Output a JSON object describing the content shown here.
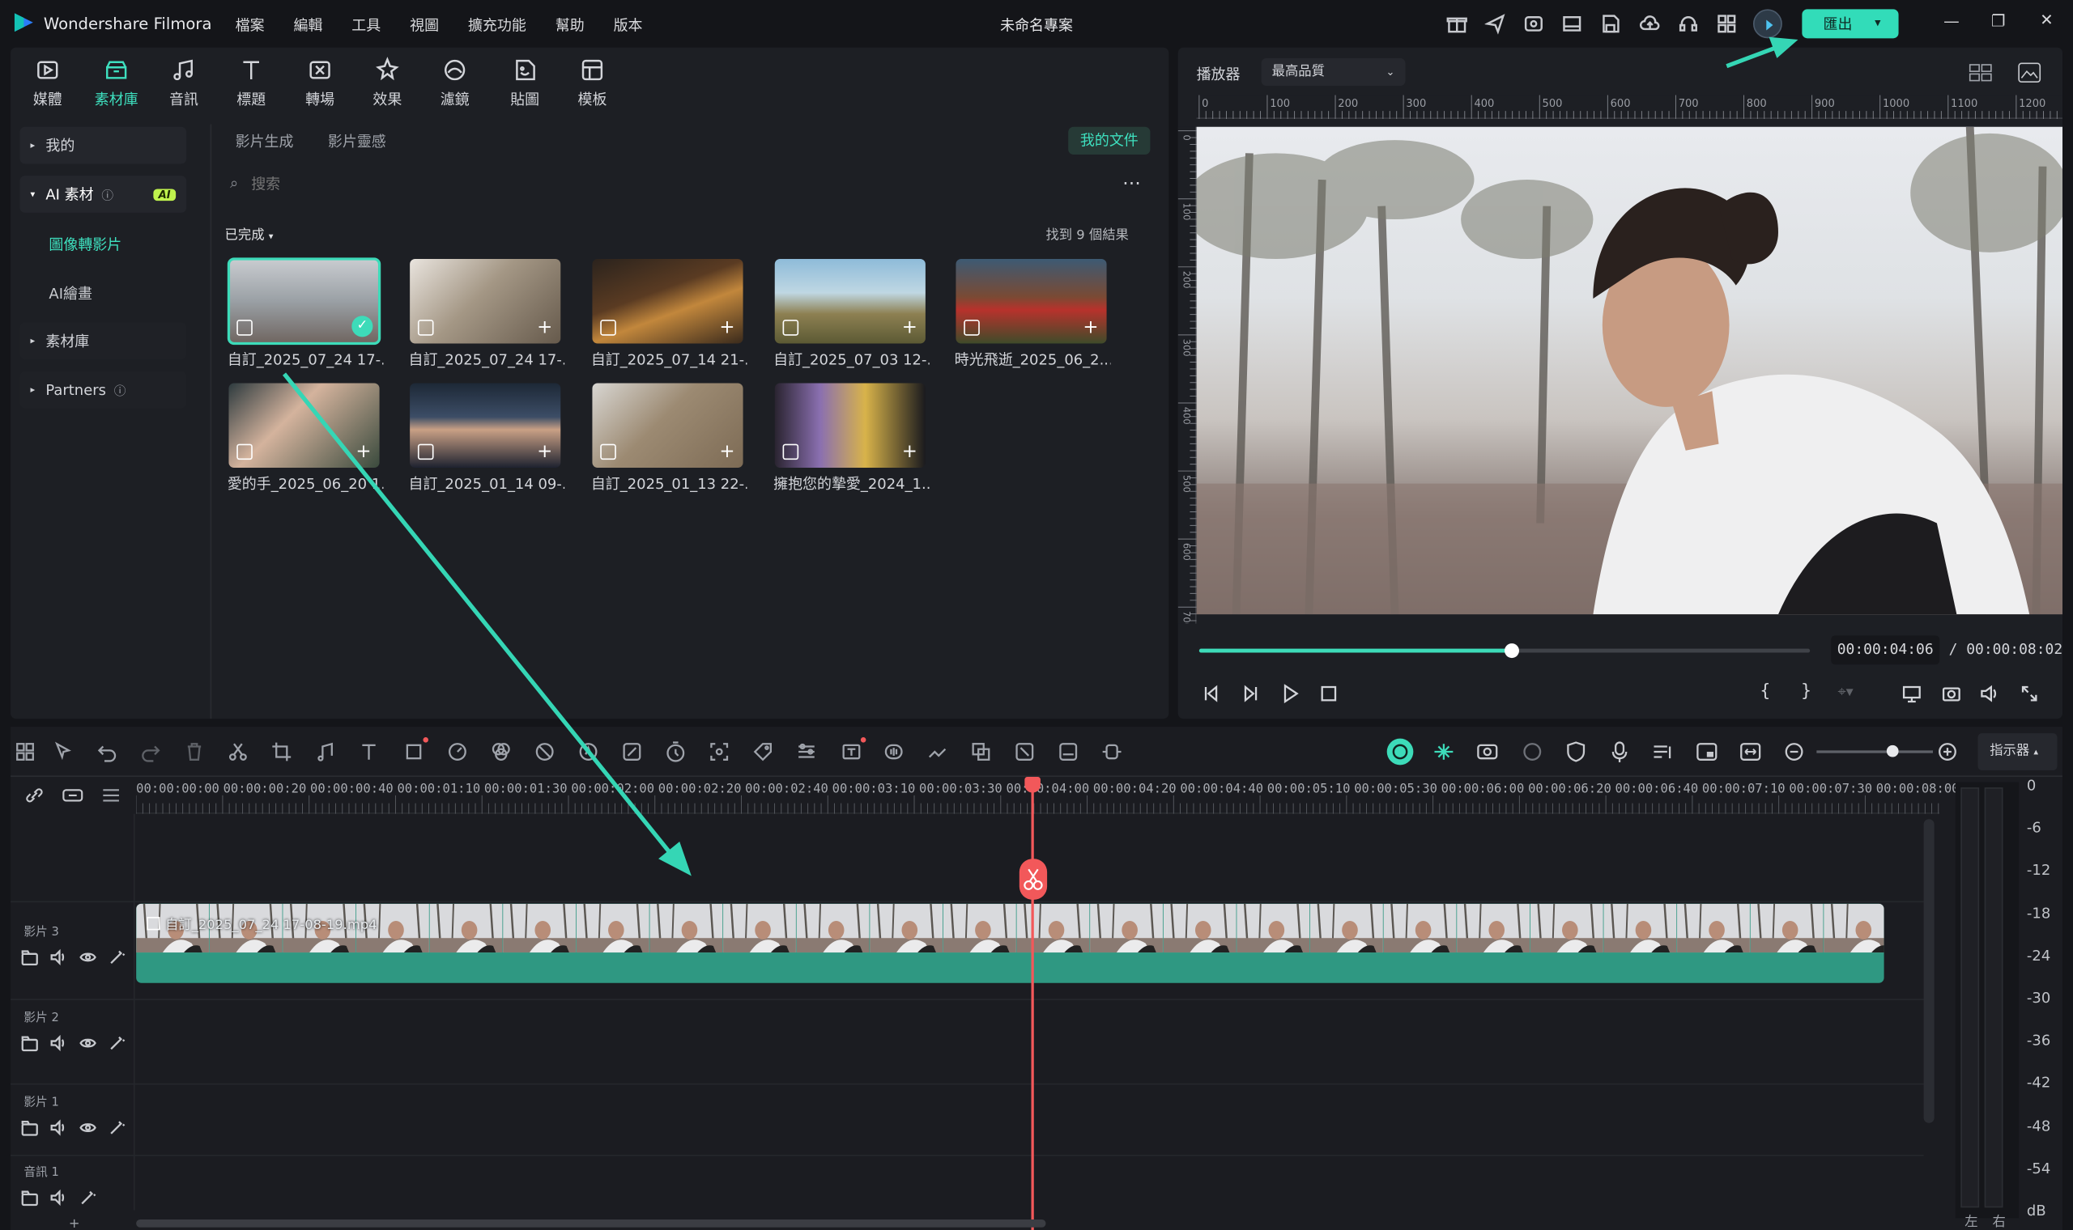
{
  "app": {
    "name": "Wondershare Filmora",
    "project_title": "未命名專案"
  },
  "menu": [
    "檔案",
    "編輯",
    "工具",
    "視圖",
    "擴充功能",
    "幫助",
    "版本"
  ],
  "export": {
    "label": "匯出"
  },
  "toolbar": [
    {
      "label": "媒體",
      "icon": "media-icon"
    },
    {
      "label": "素材庫",
      "icon": "stock-icon"
    },
    {
      "label": "音訊",
      "icon": "music-note-icon"
    },
    {
      "label": "標題",
      "icon": "title-t-icon"
    },
    {
      "label": "轉場",
      "icon": "transition-icon"
    },
    {
      "label": "效果",
      "icon": "effects-icon"
    },
    {
      "label": "濾鏡",
      "icon": "filter-icon"
    },
    {
      "label": "貼圖",
      "icon": "sticker-icon"
    },
    {
      "label": "模板",
      "icon": "template-icon"
    }
  ],
  "sidebar": {
    "mine": "我的",
    "ai": "AI 素材",
    "ai_badge": "AI",
    "img_to_video": "圖像轉影片",
    "ai_draw": "AI繪畫",
    "stock": "素材庫",
    "partners": "Partners"
  },
  "library": {
    "tabs": [
      "影片生成",
      "影片靈感"
    ],
    "my_files": "我的文件",
    "search_placeholder": "搜索",
    "filter": "已完成",
    "result_count": "找到 9 個結果",
    "items": [
      {
        "name": "自訂_2025_07_24 17-...",
        "selected": true
      },
      {
        "name": "自訂_2025_07_24 17-..."
      },
      {
        "name": "自訂_2025_07_14 21-..."
      },
      {
        "name": "自訂_2025_07_03 12-..."
      },
      {
        "name": "時光飛逝_2025_06_2..."
      },
      {
        "name": "愛的手_2025_06_20 1..."
      },
      {
        "name": "自訂_2025_01_14 09-..."
      },
      {
        "name": "自訂_2025_01_13 22-..."
      },
      {
        "name": "擁抱您的摯愛_2024_1..."
      }
    ]
  },
  "player": {
    "label": "播放器",
    "quality": "最高品質",
    "current_time": "00:00:04:06",
    "total_time": "/ 00:00:08:02",
    "progress": 0.51,
    "ruler_h": [
      "0",
      "100",
      "200",
      "300",
      "400",
      "500",
      "600",
      "700",
      "800",
      "900",
      "1000",
      "1100",
      "1200"
    ],
    "ruler_v": [
      "0",
      "100",
      "200",
      "300",
      "400",
      "500",
      "600",
      "700"
    ]
  },
  "timeline": {
    "view_label": "指示器",
    "ruler": [
      "00:00:00:00",
      "00:00:00:20",
      "00:00:00:40",
      "00:00:01:10",
      "00:00:01:30",
      "00:00:02:00",
      "00:00:02:20",
      "00:00:02:40",
      "00:00:03:10",
      "00:00:03:30",
      "00:00:04:00",
      "00:00:04:20",
      "00:00:04:40",
      "00:00:05:10",
      "00:00:05:30",
      "00:00:06:00",
      "00:00:06:20",
      "00:00:06:40",
      "00:00:07:10",
      "00:00:07:30",
      "00:00:08:00"
    ],
    "clip_name": "自訂_2025_07_24 17-08-19.mp4",
    "tracks": [
      "影片 3",
      "影片 2",
      "影片 1",
      "音訊 1"
    ],
    "db_scale": [
      "0",
      "-6",
      "-12",
      "-18",
      "-24",
      "-30",
      "-36",
      "-42",
      "-48",
      "-54",
      "dB"
    ],
    "lr": [
      "左",
      "右"
    ]
  },
  "colors": {
    "accent": "#2ad4b4",
    "arrow": "#35d6b5",
    "playhead": "#f2585a",
    "clip": "#2f9882"
  }
}
